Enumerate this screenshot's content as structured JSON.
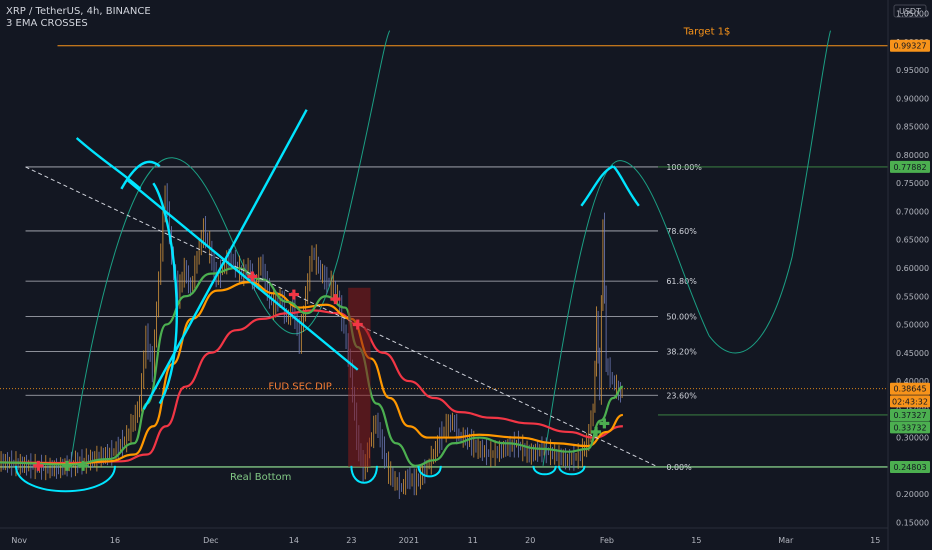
{
  "header": {
    "symbol_line": "XRP / TetherUS, 4h, BINANCE",
    "indicator": "3 EMA CROSSES",
    "currency": "USDT"
  },
  "colors": {
    "background": "#131722",
    "candle_up": "#d4953b",
    "candle_down": "#6e7ab8",
    "ema_fast": "#4caf50",
    "ema_mid": "#ff9800",
    "ema_slow": "#f23645",
    "trend": "#00e5ff",
    "arc": "#1b9e83",
    "fib": "#d1d4dc",
    "target": "#f7931a",
    "bottom": "#81c784"
  },
  "chart_data": {
    "type": "line",
    "title": "XRP / TetherUS, 4h, BINANCE",
    "y_axis": {
      "label": "USDT",
      "range": [
        0.14,
        1.06
      ],
      "ticks": [
        "1.05000",
        "1.00000",
        "0.95000",
        "0.90000",
        "0.85000",
        "0.80000",
        "0.75000",
        "0.70000",
        "0.65000",
        "0.60000",
        "0.55000",
        "0.50000",
        "0.45000",
        "0.40000",
        "0.35000",
        "0.30000",
        "0.25000",
        "0.20000",
        "0.15000"
      ]
    },
    "x_axis": {
      "ticks": [
        "Nov",
        "16",
        "Dec",
        "14",
        "23",
        "2021",
        "11",
        "20",
        "Feb",
        "15",
        "Mar",
        "15"
      ]
    },
    "x_range_days": [
      -3,
      136
    ],
    "tick_days": [
      0,
      15,
      30,
      43,
      52,
      61,
      71,
      80,
      92,
      106,
      120,
      134
    ],
    "price_path": [
      [
        -3,
        0.258
      ],
      [
        3,
        0.248
      ],
      [
        6,
        0.245
      ],
      [
        9,
        0.255
      ],
      [
        12,
        0.262
      ],
      [
        15,
        0.275
      ],
      [
        17,
        0.3
      ],
      [
        19,
        0.36
      ],
      [
        20,
        0.48
      ],
      [
        21,
        0.42
      ],
      [
        22,
        0.58
      ],
      [
        23,
        0.74
      ],
      [
        24,
        0.62
      ],
      [
        25,
        0.55
      ],
      [
        26,
        0.6
      ],
      [
        27,
        0.56
      ],
      [
        28,
        0.62
      ],
      [
        29,
        0.67
      ],
      [
        30,
        0.63
      ],
      [
        31,
        0.58
      ],
      [
        32,
        0.6
      ],
      [
        33,
        0.62
      ],
      [
        35,
        0.59
      ],
      [
        36,
        0.6
      ],
      [
        37,
        0.57
      ],
      [
        38,
        0.61
      ],
      [
        39,
        0.56
      ],
      [
        40,
        0.53
      ],
      [
        41,
        0.55
      ],
      [
        42,
        0.51
      ],
      [
        43,
        0.53
      ],
      [
        44,
        0.47
      ],
      [
        45,
        0.55
      ],
      [
        46,
        0.63
      ],
      [
        47,
        0.6
      ],
      [
        48,
        0.58
      ],
      [
        49,
        0.57
      ],
      [
        50,
        0.55
      ],
      [
        51,
        0.49
      ],
      [
        52,
        0.42
      ],
      [
        53,
        0.3
      ],
      [
        54,
        0.24
      ],
      [
        55,
        0.29
      ],
      [
        56,
        0.33
      ],
      [
        57,
        0.28
      ],
      [
        58,
        0.24
      ],
      [
        59,
        0.22
      ],
      [
        60,
        0.21
      ],
      [
        61,
        0.23
      ],
      [
        62,
        0.22
      ],
      [
        63,
        0.23
      ],
      [
        64,
        0.25
      ],
      [
        65,
        0.27
      ],
      [
        66,
        0.3
      ],
      [
        67,
        0.32
      ],
      [
        68,
        0.33
      ],
      [
        69,
        0.3
      ],
      [
        70,
        0.3
      ],
      [
        71,
        0.29
      ],
      [
        72,
        0.28
      ],
      [
        74,
        0.27
      ],
      [
        76,
        0.28
      ],
      [
        78,
        0.29
      ],
      [
        80,
        0.27
      ],
      [
        82,
        0.28
      ],
      [
        84,
        0.27
      ],
      [
        86,
        0.26
      ],
      [
        88,
        0.27
      ],
      [
        89,
        0.29
      ],
      [
        90,
        0.35
      ],
      [
        90.5,
        0.51
      ],
      [
        91,
        0.38
      ],
      [
        91.5,
        0.68
      ],
      [
        92,
        0.43
      ],
      [
        93,
        0.4
      ],
      [
        94,
        0.38
      ],
      [
        94.5,
        0.38
      ]
    ],
    "series": [
      {
        "name": "EMA fast",
        "color": "#4caf50",
        "points": [
          [
            -3,
            0.256
          ],
          [
            8,
            0.252
          ],
          [
            14,
            0.262
          ],
          [
            18,
            0.29
          ],
          [
            20,
            0.36
          ],
          [
            23,
            0.5
          ],
          [
            26,
            0.55
          ],
          [
            30,
            0.59
          ],
          [
            34,
            0.6
          ],
          [
            38,
            0.58
          ],
          [
            42,
            0.54
          ],
          [
            45,
            0.52
          ],
          [
            48,
            0.55
          ],
          [
            51,
            0.53
          ],
          [
            53,
            0.46
          ],
          [
            56,
            0.36
          ],
          [
            59,
            0.29
          ],
          [
            62,
            0.25
          ],
          [
            65,
            0.26
          ],
          [
            68,
            0.29
          ],
          [
            72,
            0.3
          ],
          [
            76,
            0.29
          ],
          [
            82,
            0.28
          ],
          [
            86,
            0.275
          ],
          [
            89,
            0.28
          ],
          [
            91,
            0.33
          ],
          [
            93,
            0.37
          ],
          [
            94.5,
            0.39
          ]
        ]
      },
      {
        "name": "EMA mid",
        "color": "#ff9800",
        "points": [
          [
            -3,
            0.256
          ],
          [
            8,
            0.253
          ],
          [
            14,
            0.258
          ],
          [
            18,
            0.27
          ],
          [
            21,
            0.32
          ],
          [
            24,
            0.43
          ],
          [
            27,
            0.51
          ],
          [
            31,
            0.56
          ],
          [
            36,
            0.575
          ],
          [
            40,
            0.555
          ],
          [
            44,
            0.53
          ],
          [
            48,
            0.535
          ],
          [
            52,
            0.51
          ],
          [
            55,
            0.44
          ],
          [
            58,
            0.37
          ],
          [
            61,
            0.32
          ],
          [
            64,
            0.3
          ],
          [
            68,
            0.3
          ],
          [
            72,
            0.305
          ],
          [
            78,
            0.3
          ],
          [
            84,
            0.29
          ],
          [
            89,
            0.285
          ],
          [
            92,
            0.31
          ],
          [
            94.5,
            0.34
          ]
        ]
      },
      {
        "name": "EMA slow",
        "color": "#f23645",
        "points": [
          [
            -3,
            0.256
          ],
          [
            8,
            0.255
          ],
          [
            16,
            0.258
          ],
          [
            20,
            0.27
          ],
          [
            23,
            0.32
          ],
          [
            26,
            0.39
          ],
          [
            30,
            0.45
          ],
          [
            34,
            0.49
          ],
          [
            38,
            0.51
          ],
          [
            42,
            0.52
          ],
          [
            46,
            0.525
          ],
          [
            50,
            0.52
          ],
          [
            53,
            0.5
          ],
          [
            57,
            0.45
          ],
          [
            61,
            0.4
          ],
          [
            65,
            0.37
          ],
          [
            69,
            0.345
          ],
          [
            74,
            0.335
          ],
          [
            80,
            0.325
          ],
          [
            86,
            0.31
          ],
          [
            90,
            0.3
          ],
          [
            94.5,
            0.32
          ]
        ]
      }
    ],
    "fib_levels": [
      {
        "label": "100.00%",
        "value": 0.7788
      },
      {
        "label": "78.60%",
        "value": 0.6656
      },
      {
        "label": "61.80%",
        "value": 0.5768
      },
      {
        "label": "50.00%",
        "value": 0.5144
      },
      {
        "label": "38.20%",
        "value": 0.452
      },
      {
        "label": "23.60%",
        "value": 0.3748
      },
      {
        "label": "0.00%",
        "value": 0.248
      }
    ],
    "price_badges": [
      {
        "text": "0.99327",
        "value": 0.99327,
        "color": "#f7931a"
      },
      {
        "text": "0.77882",
        "value": 0.77882,
        "color": "#4caf50"
      },
      {
        "text": "0.38645",
        "value": 0.38645,
        "color": "#f7931a"
      },
      {
        "text": "02:43:32",
        "value": 0.364,
        "color": "#f7931a"
      },
      {
        "text": "0.37327",
        "value": 0.34,
        "color": "#4caf50"
      },
      {
        "text": "0.33732",
        "value": 0.318,
        "color": "#4caf50"
      },
      {
        "text": "0.24803",
        "value": 0.24803,
        "color": "#4caf50"
      }
    ],
    "annotations": {
      "target": "Target 1$",
      "fud": "FUD SEC DIP",
      "bottom": "Real Bottom"
    }
  }
}
